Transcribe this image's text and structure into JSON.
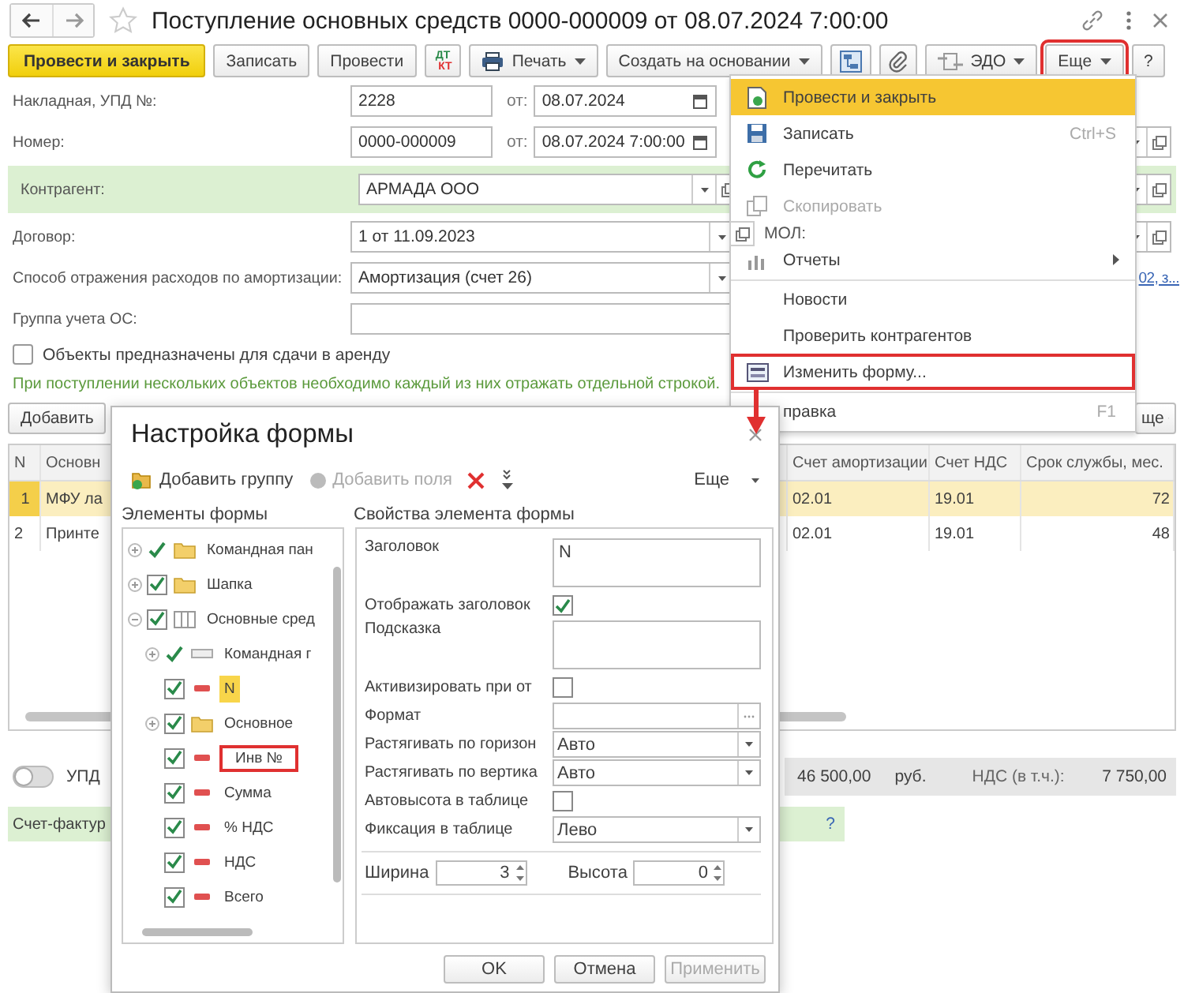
{
  "window": {
    "title": "Поступление основных средств 0000-000009 от 08.07.2024 7:00:00"
  },
  "toolbar": [
    {
      "label": "Провести и закрыть",
      "kind": "primary",
      "outlined": false
    },
    {
      "label": "Записать",
      "kind": "plain",
      "outlined": false
    },
    {
      "label": "Провести",
      "kind": "plain",
      "outlined": false
    },
    {
      "label": "ДТ",
      "label_2": "КТ",
      "kind": "dtkt",
      "outlined": false
    },
    {
      "label": "Печать",
      "kind": "print",
      "outlined": false
    },
    {
      "label": "Создать на основании",
      "kind": "dropdown",
      "outlined": false
    },
    {
      "kind": "structure",
      "outlined": false
    },
    {
      "kind": "clip",
      "outlined": false
    },
    {
      "label": "ЭДО",
      "kind": "edo",
      "outlined": false
    },
    {
      "label": "Еще",
      "kind": "dropdown",
      "outlined": true
    },
    {
      "label": "?",
      "kind": "plain",
      "outlined": false
    }
  ],
  "fields": [
    {
      "label": "Накладная, УПД №:",
      "kind": "number-date",
      "value": "2228",
      "date_label": "от:",
      "date": "08.07.2024",
      "highlighted": false,
      "side_field": false
    },
    {
      "label": "Номер:",
      "kind": "number-date",
      "value": "0000-000009",
      "date_label": "от:",
      "date": "08.07.2024  7:00:00",
      "highlighted": false,
      "side_field": true
    },
    {
      "label": "Контрагент:",
      "kind": "ref",
      "value": "АРМАДА ООО",
      "highlighted": true,
      "side_field": true
    },
    {
      "label": "Договор:",
      "kind": "select",
      "value": "1 от 11.09.2023",
      "highlighted": false,
      "side_field": true
    },
    {
      "label": "Способ отражения расходов по амортизации:",
      "kind": "select",
      "value": "Амортизация (счет 26)",
      "highlighted": false,
      "side_link": "02, з..."
    },
    {
      "label": "Группа учета ОС:",
      "kind": "text",
      "highlighted": false,
      "side_field": false
    }
  ],
  "mol_label": "МОЛ:",
  "rent_checkbox": {
    "label": "Объекты предназначены для сдачи в аренду",
    "checked": false
  },
  "hint": "При поступлении нескольких объектов необходимо каждый из них отражать отдельной строкой.",
  "table_toolbar": {
    "add": "Добавить",
    "more": "ще"
  },
  "table": {
    "columns": [
      "N",
      "Основн",
      "Счет амортизации",
      "Счет НДС",
      "Срок службы, мес."
    ],
    "rows": [
      {
        "selected": true,
        "cells": [
          "1",
          "МФУ ла",
          "02.01",
          "19.01",
          "72"
        ]
      },
      {
        "selected": false,
        "cells": [
          "2",
          "Принте",
          "02.01",
          "19.01",
          "48"
        ]
      }
    ]
  },
  "footer": {
    "toggle_label": "УПД",
    "toggle_on": false,
    "total": "46 500,00",
    "currency": "руб.",
    "vat_label": "НДС (в т.ч.):",
    "vat": "7 750,00"
  },
  "invoice_bar": {
    "label": "Счет-фактур",
    "help": "?"
  },
  "menu": {
    "items": [
      {
        "label": "Провести и закрыть",
        "kind": "post",
        "selected": true,
        "disabled": false,
        "outlined": false,
        "separator_before": false
      },
      {
        "label": "Записать",
        "shortcut": "Ctrl+S",
        "kind": "save",
        "selected": false,
        "disabled": false,
        "outlined": false,
        "separator_before": false
      },
      {
        "label": "Перечитать",
        "kind": "reload",
        "selected": false,
        "disabled": false,
        "outlined": false,
        "separator_before": false
      },
      {
        "label": "Скопировать",
        "kind": "copy",
        "selected": false,
        "disabled": true,
        "outlined": false,
        "separator_before": false
      },
      {
        "label": "Отчеты",
        "kind": "reports",
        "submenu": true,
        "selected": false,
        "disabled": false,
        "outlined": false,
        "separator_before": false
      },
      {
        "label": "Новости",
        "kind": "none",
        "selected": false,
        "disabled": false,
        "outlined": false,
        "separator_before": true
      },
      {
        "label": "Проверить контрагентов",
        "kind": "none",
        "selected": false,
        "disabled": false,
        "outlined": false,
        "separator_before": false
      },
      {
        "label": "Изменить форму...",
        "kind": "form",
        "selected": false,
        "disabled": false,
        "outlined": true,
        "separator_before": false
      },
      {
        "label": "правка",
        "shortcut": "F1",
        "kind": "none",
        "selected": false,
        "disabled": false,
        "outlined": false,
        "separator_before": true
      }
    ]
  },
  "dialog": {
    "title": "Настройка формы",
    "toolbar": [
      {
        "label": "Добавить группу",
        "kind": "add-group",
        "disabled": false
      },
      {
        "label": "Добавить поля",
        "kind": "add-fields",
        "disabled": true
      },
      {
        "kind": "delete",
        "disabled": false
      },
      {
        "kind": "move",
        "disabled": false
      },
      {
        "label": "Еще",
        "kind": "more",
        "disabled": false
      }
    ],
    "elements_label": "Элементы формы",
    "properties_label": "Свойства элемента формы",
    "tree": [
      {
        "label": "Командная пан",
        "kind": "command-panel",
        "checked": true,
        "expanded": false,
        "selected": false,
        "outlined": false
      },
      {
        "label": "Шапка",
        "kind": "group",
        "checked": true,
        "expanded": false,
        "selected": false,
        "outlined": false
      },
      {
        "label": "Основные сред",
        "kind": "table",
        "checked": true,
        "expanded": true,
        "selected": false,
        "outlined": false,
        "children": [
          {
            "label": "Командная г",
            "kind": "command-bar",
            "checked": true,
            "expanded": false,
            "selected": false,
            "outlined": false
          },
          {
            "label": "N",
            "kind": "field",
            "checked": true,
            "selected": true,
            "outlined": false
          },
          {
            "label": "Основное",
            "kind": "group",
            "checked": true,
            "expanded": false,
            "selected": false,
            "outlined": false
          },
          {
            "label": "Инв №",
            "kind": "field",
            "checked": true,
            "selected": false,
            "outlined": true
          },
          {
            "label": "Сумма",
            "kind": "field",
            "checked": true,
            "selected": false,
            "outlined": false
          },
          {
            "label": "% НДС",
            "kind": "field",
            "checked": true,
            "selected": false,
            "outlined": false
          },
          {
            "label": "НДС",
            "kind": "field",
            "checked": true,
            "selected": false,
            "outlined": false
          },
          {
            "label": "Всего",
            "kind": "field",
            "checked": true,
            "selected": false,
            "outlined": false
          }
        ]
      }
    ],
    "properties": [
      {
        "label": "Заголовок",
        "kind": "textarea",
        "value": "N"
      },
      {
        "label": "Отображать заголовок",
        "kind": "checkbox",
        "checked": true
      },
      {
        "label": "Подсказка",
        "kind": "textarea"
      },
      {
        "label": "Активизировать при от",
        "kind": "checkbox",
        "checked": false
      },
      {
        "label": "Формат",
        "kind": "choice"
      },
      {
        "label": "Растягивать по горизон",
        "kind": "select",
        "value": "Авто"
      },
      {
        "label": "Растягивать по вертика",
        "kind": "select",
        "value": "Авто"
      },
      {
        "label": "Автовысота в таблице",
        "kind": "checkbox",
        "checked": false
      },
      {
        "label": "Фиксация в таблице",
        "kind": "select",
        "value": "Лево"
      }
    ],
    "size": [
      {
        "label": "Ширина",
        "value": "3"
      },
      {
        "label": "Высота",
        "value": "0"
      }
    ],
    "buttons": [
      {
        "label": "OK",
        "disabled": false
      },
      {
        "label": "Отмена",
        "disabled": false
      },
      {
        "label": "Применить",
        "disabled": true
      }
    ]
  }
}
